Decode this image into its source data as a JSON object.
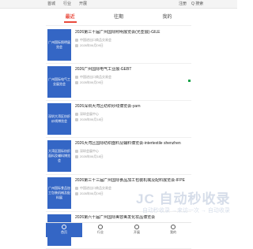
{
  "topbar": {
    "left": [
      "首城",
      "行业",
      "开展"
    ],
    "right": [
      "注册",
      "Q 搜索"
    ]
  },
  "tabs": [
    {
      "label": "最近",
      "active": true
    },
    {
      "label": "往期",
      "active": false
    },
    {
      "label": "我的",
      "active": false
    }
  ],
  "items": [
    {
      "thumb": "广州国际照明展览会",
      "title": "2026第三十届广州国际照明展览会(光亚展)-GILE",
      "location": "中国进出口商品交易会",
      "date": "2026年06月09日"
    },
    {
      "thumb": "广州国际电气工业展览会",
      "title": "2026广州国际电气工业展-GEBT",
      "location": "中国进出口商品交易会",
      "date": "2026年06月09日"
    },
    {
      "thumb": "深圳大湾区纺织纱线博览会",
      "title": "2026深圳大湾区纺织纱线博览会-yarn",
      "location": "深圳会展中心",
      "date": "2026年06月18日"
    },
    {
      "thumb": "大湾区国际纺织面料及辅料博览会",
      "title": "2026大湾区国际纺织面料及辅料博览会-intertextile shenzhen",
      "location": "深圳会展中心",
      "date": "2026年06月18日"
    },
    {
      "thumb": "广州国际食品加工包装机械及配料展",
      "title": "2026第三十三届广州国际食品加工包装机械及配料展览会-IFPE",
      "location": "中国进出口商品交易会",
      "date": "2026年06月09日"
    },
    {
      "thumb": "广州国际美容美发化妆品博览会",
      "title": "2026第六十届广州国际美容美发化妆品博览会",
      "location": "中国进出口商品交易会",
      "date": "2026年09月03日"
    }
  ],
  "bottomnav": [
    {
      "label": "首页",
      "icon": "home-icon",
      "active": true
    },
    {
      "label": "行业",
      "icon": "grid-icon",
      "active": false
    },
    {
      "label": "开展",
      "icon": "calendar-icon",
      "active": false
    },
    {
      "label": "我的",
      "icon": "user-icon",
      "active": false
    }
  ],
  "watermark": {
    "big": "JC 自动秒收录",
    "small": "自动秒收录 →来访一次 → 自动收录"
  },
  "colors": {
    "accent": "#e94a3c",
    "thumb": "#3466c5",
    "mark": "#1aa34a"
  }
}
